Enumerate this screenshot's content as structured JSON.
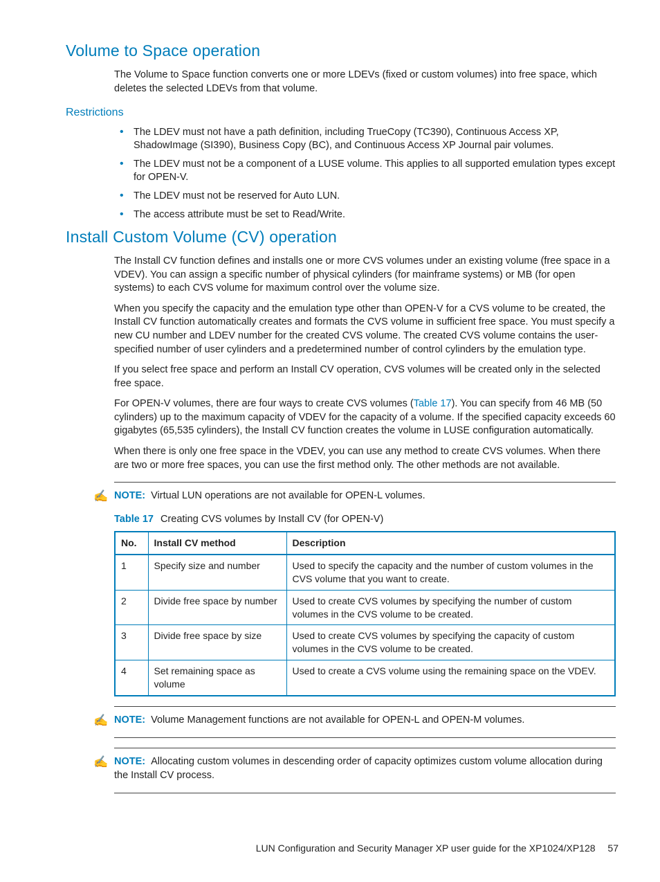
{
  "sections": {
    "vts_heading": "Volume to Space operation",
    "vts_para": "The Volume to Space function converts one or more LDEVs (fixed or custom volumes) into free space, which deletes the selected LDEVs from that volume.",
    "restrictions_heading": "Restrictions",
    "restrictions": [
      "The LDEV must not have a path definition, including TrueCopy (TC390), Continuous Access XP, ShadowImage (SI390), Business Copy (BC), and Continuous Access XP Journal pair volumes.",
      "The LDEV must not be a component of a LUSE volume. This applies to all supported emulation types except for OPEN-V.",
      "The LDEV must not be reserved for Auto LUN.",
      "The access attribute must be set to Read/Write."
    ],
    "icv_heading": "Install Custom Volume (CV) operation",
    "icv_p1": "The Install CV function defines and installs one or more CVS volumes under an existing volume (free space in a VDEV). You can assign a specific number of physical cylinders (for mainframe systems) or MB (for open systems) to each CVS volume for maximum control over the volume size.",
    "icv_p2": "When you specify the capacity and the emulation type other than OPEN-V for a CVS volume to be created, the Install CV function automatically creates and formats the CVS volume in sufficient free space. You must specify a new CU number and LDEV number for the created CVS volume. The created CVS volume contains the user-specified number of user cylinders and a predetermined number of control cylinders by the emulation type.",
    "icv_p3": "If you select free space and perform an Install CV operation, CVS volumes will be created only in the selected free space.",
    "icv_p4_pre": "For OPEN-V volumes, there are four ways to create CVS volumes (",
    "icv_p4_link": "Table 17",
    "icv_p4_post": "). You can specify from 46 MB (50 cylinders) up to the maximum capacity of VDEV for the capacity of a volume. If the specified capacity exceeds 60 gigabytes (65,535 cylinders), the Install CV function creates the volume in LUSE configuration automatically.",
    "icv_p5": "When there is only one free space in the VDEV, you can use any method to create CVS volumes. When there are two or more free spaces, you can use the first method only. The other methods are not available."
  },
  "notes": {
    "label": "NOTE:",
    "n1": "Virtual LUN operations are not available for OPEN-L volumes.",
    "n2": "Volume Management functions are not available for OPEN-L and OPEN-M volumes.",
    "n3": "Allocating custom volumes in descending order of capacity optimizes custom volume allocation during the Install CV process."
  },
  "table17": {
    "caption_label": "Table 17",
    "caption_text": "Creating CVS volumes by Install CV (for OPEN-V)",
    "headers": {
      "no": "No.",
      "method": "Install CV method",
      "desc": "Description"
    },
    "rows": [
      {
        "no": "1",
        "method": "Specify size and number",
        "desc": "Used to specify the capacity and the number of custom volumes in the CVS volume that you want to create."
      },
      {
        "no": "2",
        "method": "Divide free space by number",
        "desc": "Used to create CVS volumes by specifying the number of custom volumes in the CVS volume to be created."
      },
      {
        "no": "3",
        "method": "Divide free space by size",
        "desc": "Used to create CVS volumes by specifying the capacity of custom volumes in the CVS volume to be created."
      },
      {
        "no": "4",
        "method": "Set remaining space as volume",
        "desc": "Used to create a CVS volume using the remaining space on the VDEV."
      }
    ]
  },
  "footer": {
    "title": "LUN Configuration and Security Manager XP user guide for the XP1024/XP128",
    "page": "57"
  }
}
